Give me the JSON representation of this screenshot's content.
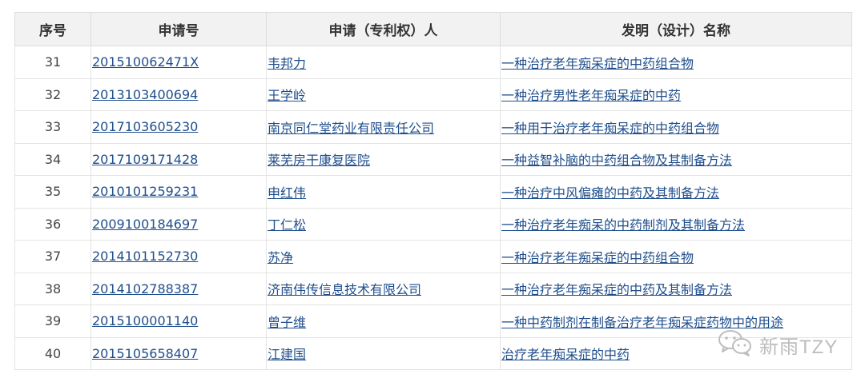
{
  "table": {
    "headers": [
      "序号",
      "申请号",
      "申请（专利权）人",
      "发明（设计）名称"
    ],
    "rows": [
      [
        "31",
        "201510062471X",
        "韦邦力",
        "一种治疗老年痴呆症的中药组合物"
      ],
      [
        "32",
        "2013103400694",
        "王学岭",
        "一种治疗男性老年痴呆症的中药"
      ],
      [
        "33",
        "2017103605230",
        "南京同仁堂药业有限责任公司",
        "一种用于治疗老年痴呆症的中药组合物"
      ],
      [
        "34",
        "2017109171428",
        "莱芜房干康复医院",
        "一种益智补脑的中药组合物及其制备方法"
      ],
      [
        "35",
        "2010101259231",
        "申红伟",
        "一种治疗中风偏瘫的中药及其制备方法"
      ],
      [
        "36",
        "2009100184697",
        "丁仁松",
        "一种治疗老年痴呆的中药制剂及其制备方法"
      ],
      [
        "37",
        "2014101152730",
        "苏净",
        "一种治疗老年痴呆症的中药组合物"
      ],
      [
        "38",
        "2014102788387",
        "济南伟传信息技术有限公司",
        "一种治疗老年痴呆症的中药及其制备方法"
      ],
      [
        "39",
        "2015100001140",
        "曾子维",
        "一种中药制剂在制备治疗老年痴呆症药物中的用途"
      ],
      [
        "40",
        "2015105658407",
        "江建国",
        "治疗老年痴呆症的中药"
      ]
    ]
  },
  "watermark": {
    "icon": "wechat-icon",
    "text": "新雨TZY"
  },
  "colors": {
    "header_bg": "#f2f2f2",
    "link": "#1f4e8c",
    "border": "#e3e3e3",
    "watermark": "#bdbdbd"
  }
}
